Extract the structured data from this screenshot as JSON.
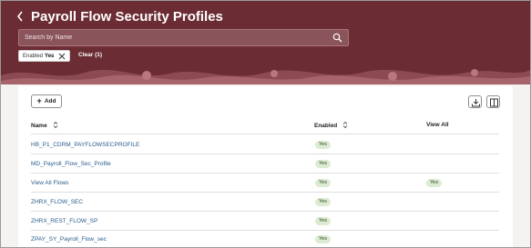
{
  "header": {
    "title": "Payroll Flow Security Profiles",
    "search_placeholder": "Search by Name"
  },
  "filter_chip": {
    "label": "Enabled",
    "value": "Yes"
  },
  "clear_label": "Clear (1)",
  "toolbar": {
    "add_label": "Add"
  },
  "table": {
    "columns": {
      "name": "Name",
      "enabled": "Enabled",
      "view_all": "View All"
    },
    "rows": [
      {
        "name": "HB_P1_CDRM_PAYFLOWSECPROFILE",
        "enabled": "Yes",
        "view_all": ""
      },
      {
        "name": "MD_Payroll_Flow_Sec_Profile",
        "enabled": "Yes",
        "view_all": ""
      },
      {
        "name": "View All Flows",
        "enabled": "Yes",
        "view_all": "Yes"
      },
      {
        "name": "ZHRX_FLOW_SEC",
        "enabled": "Yes",
        "view_all": ""
      },
      {
        "name": "ZHRX_REST_FLOW_SP",
        "enabled": "Yes",
        "view_all": ""
      },
      {
        "name": "ZPAY_SY_Payroll_Flow_sec",
        "enabled": "Yes",
        "view_all": ""
      }
    ]
  },
  "colors": {
    "banner": "#6b2c34",
    "link": "#2a5e8c",
    "badge_bg": "#dcebd2",
    "badge_text": "#2f4a22"
  }
}
